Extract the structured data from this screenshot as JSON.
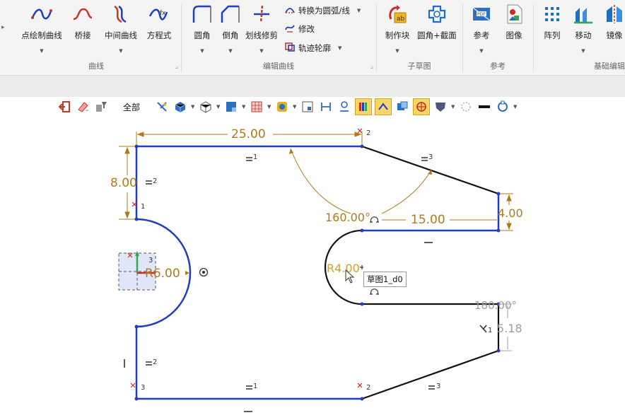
{
  "ribbon": {
    "groups": [
      {
        "label": "曲线"
      },
      {
        "label": "编辑曲线"
      },
      {
        "label": "子草图"
      },
      {
        "label": "参考"
      },
      {
        "label": "基础编辑"
      }
    ],
    "buttons": {
      "freehand": "点绘制曲线",
      "bridge": "桥接",
      "middle": "中间曲线",
      "equation": "方程式",
      "fillet": "圆角",
      "chamfer": "倒角",
      "trim": "划线修剪",
      "convert": "转换为圆弧/线",
      "modify": "修改",
      "trace": "轨迹轮廓",
      "make_block": "制作块",
      "fillet_section": "圆角+截面",
      "reference": "参考",
      "image": "图像",
      "array": "阵列",
      "move": "移动",
      "mirror": "镜像"
    }
  },
  "toolbar": {
    "filter_label": "全部"
  },
  "colors": {
    "accent": "#f8d56a",
    "sketch_blue": "#1f3fbf",
    "dimension": "#b07a1a"
  },
  "sketch": {
    "dims": {
      "top_length": "25.00",
      "left_height": "8.00",
      "angle_top": "160.00°",
      "slot_length": "15.00",
      "right_height": "4.00",
      "arc_radius": "R6.00",
      "slot_radius": "R4.00",
      "angle_bottom": "180.00°",
      "lower_right": "5.18"
    },
    "constraints": {
      "eq1": "=1",
      "eq2": "=2",
      "eq3": "=3",
      "mark1": "1",
      "mark2": "2",
      "mark3": "3"
    },
    "tooltip": "草图1_d0"
  }
}
